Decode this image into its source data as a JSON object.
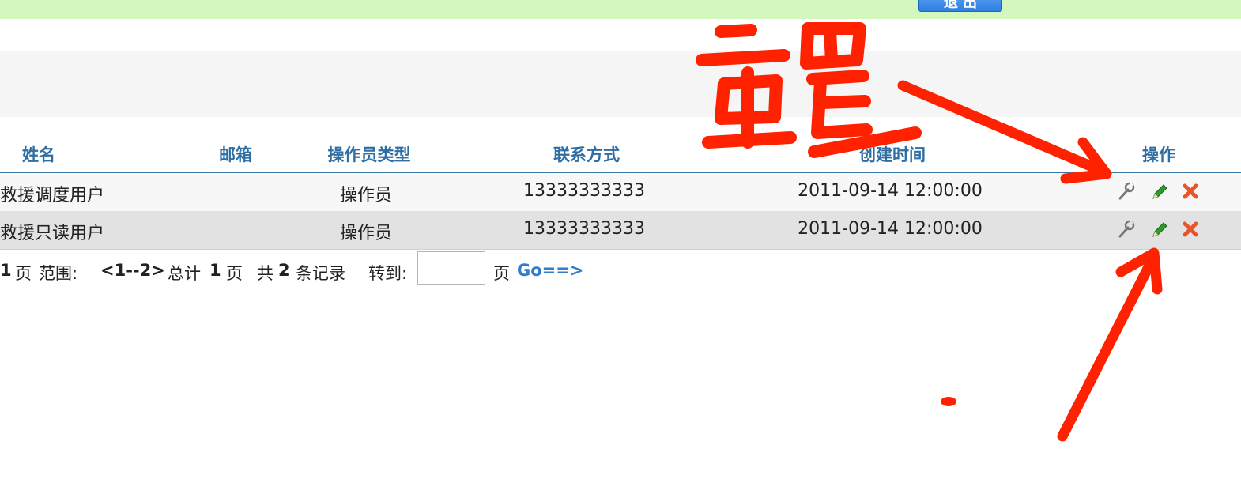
{
  "top_button": {
    "label": "退 出"
  },
  "table": {
    "headers": {
      "name": "姓名",
      "email": "邮箱",
      "type": "操作员类型",
      "contact": "联系方式",
      "created": "创建时间",
      "actions": "操作"
    },
    "rows": [
      {
        "name": "救援调度用户",
        "email": "",
        "type": "操作员",
        "contact": "13333333333",
        "created": "2011-09-14 12:00:00"
      },
      {
        "name": "救援只读用户",
        "email": "",
        "type": "操作员",
        "contact": "13333333333",
        "created": "2011-09-14 12:00:00"
      }
    ],
    "action_icons": [
      "wrench-icon",
      "pencil-icon",
      "delete-x-icon"
    ]
  },
  "pager": {
    "current_page": "1",
    "page_label": "页",
    "range_label": "范围:",
    "range_value": "<1--2>",
    "total_label": "总计",
    "total_pages": "1",
    "records_prefix": "共",
    "record_count": "2",
    "records_suffix": "条记录",
    "goto_label": "转到:",
    "goto_value": "",
    "go_link": "Go==>"
  },
  "annotation": {
    "text": "重置",
    "color": "#ff2200"
  }
}
